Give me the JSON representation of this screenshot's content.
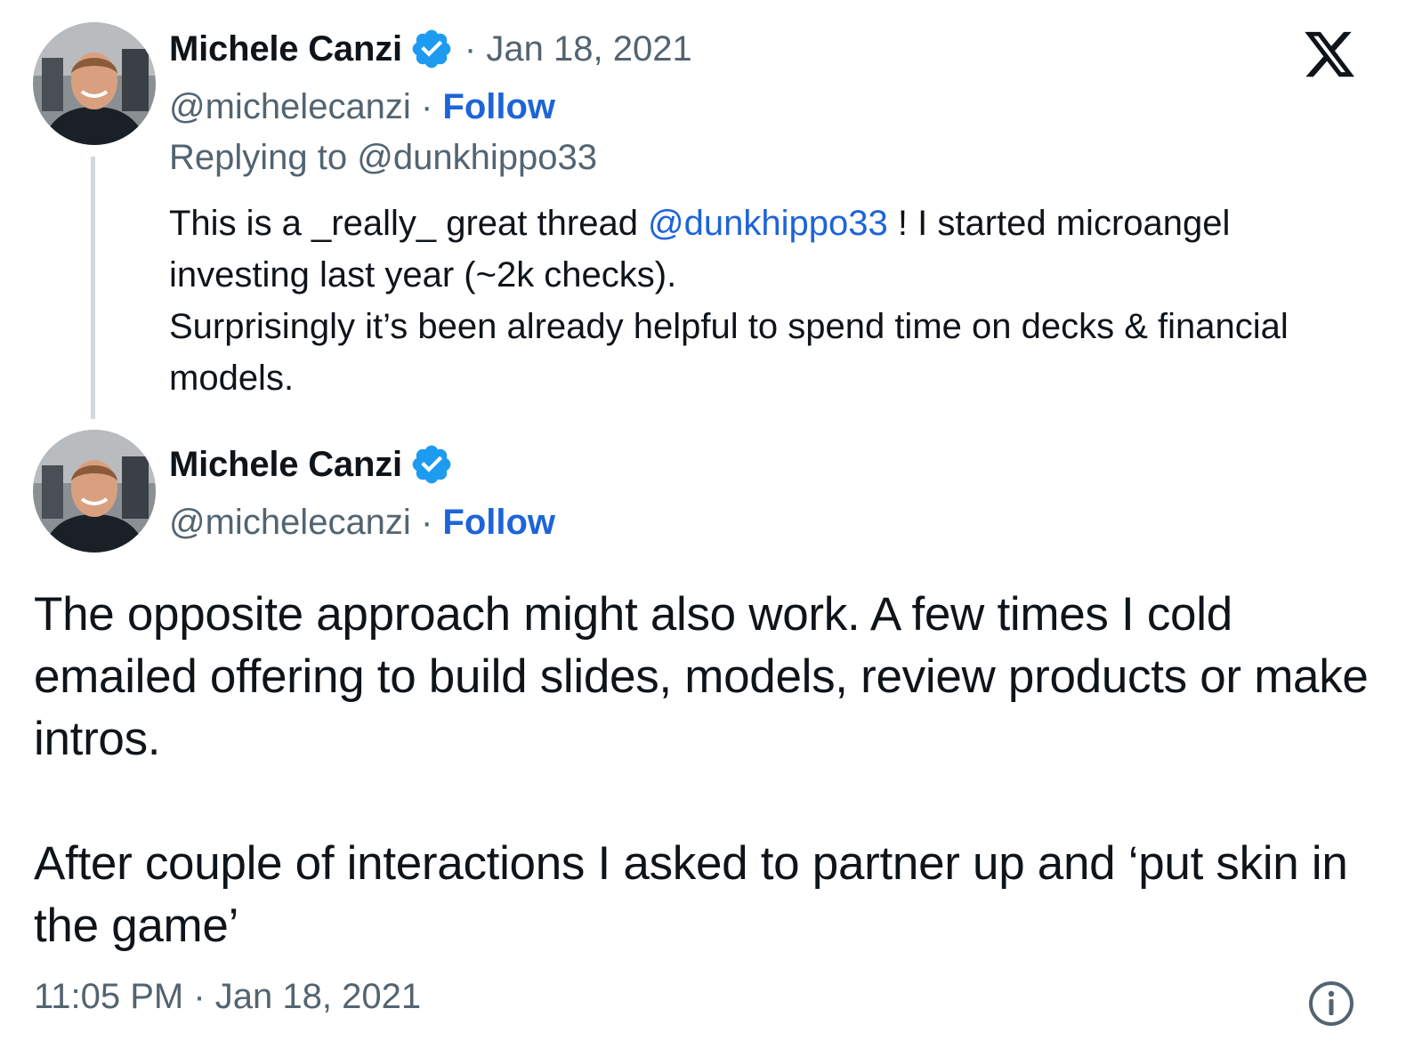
{
  "reply_tweet": {
    "author_name": "Michele Canzi",
    "verified_icon": "verified-badge-icon",
    "separator": "·",
    "date": "Jan 18, 2021",
    "handle": "@michelecanzi",
    "follow_label": "Follow",
    "replying_to_label": "Replying to @dunkhippo33",
    "text_before_mention": "This is a _really_ great thread ",
    "mention": "@dunkhippo33",
    "text_after_mention": " ! I started microangel investing last year (~2k checks).",
    "text_line2": "Surprisingly it’s been already helpful to spend time on decks & financial models."
  },
  "main_tweet": {
    "author_name": "Michele Canzi",
    "handle": "@michelecanzi",
    "separator": "·",
    "follow_label": "Follow",
    "paragraph1": "The opposite approach might also work. A few times I cold emailed offering to build slides, models, review products or make intros.",
    "paragraph2": "After couple of interactions I asked to partner up and ‘put skin in the game’",
    "timestamp": "11:05 PM · Jan 18, 2021"
  },
  "icons": {
    "logo": "x-logo-icon",
    "info": "info-icon",
    "verified": "verified-badge-icon"
  },
  "colors": {
    "link": "#1d64d8",
    "secondary_text": "#536471",
    "verified_badge": "#1d9bf0",
    "thread_line": "#cfd9de"
  }
}
